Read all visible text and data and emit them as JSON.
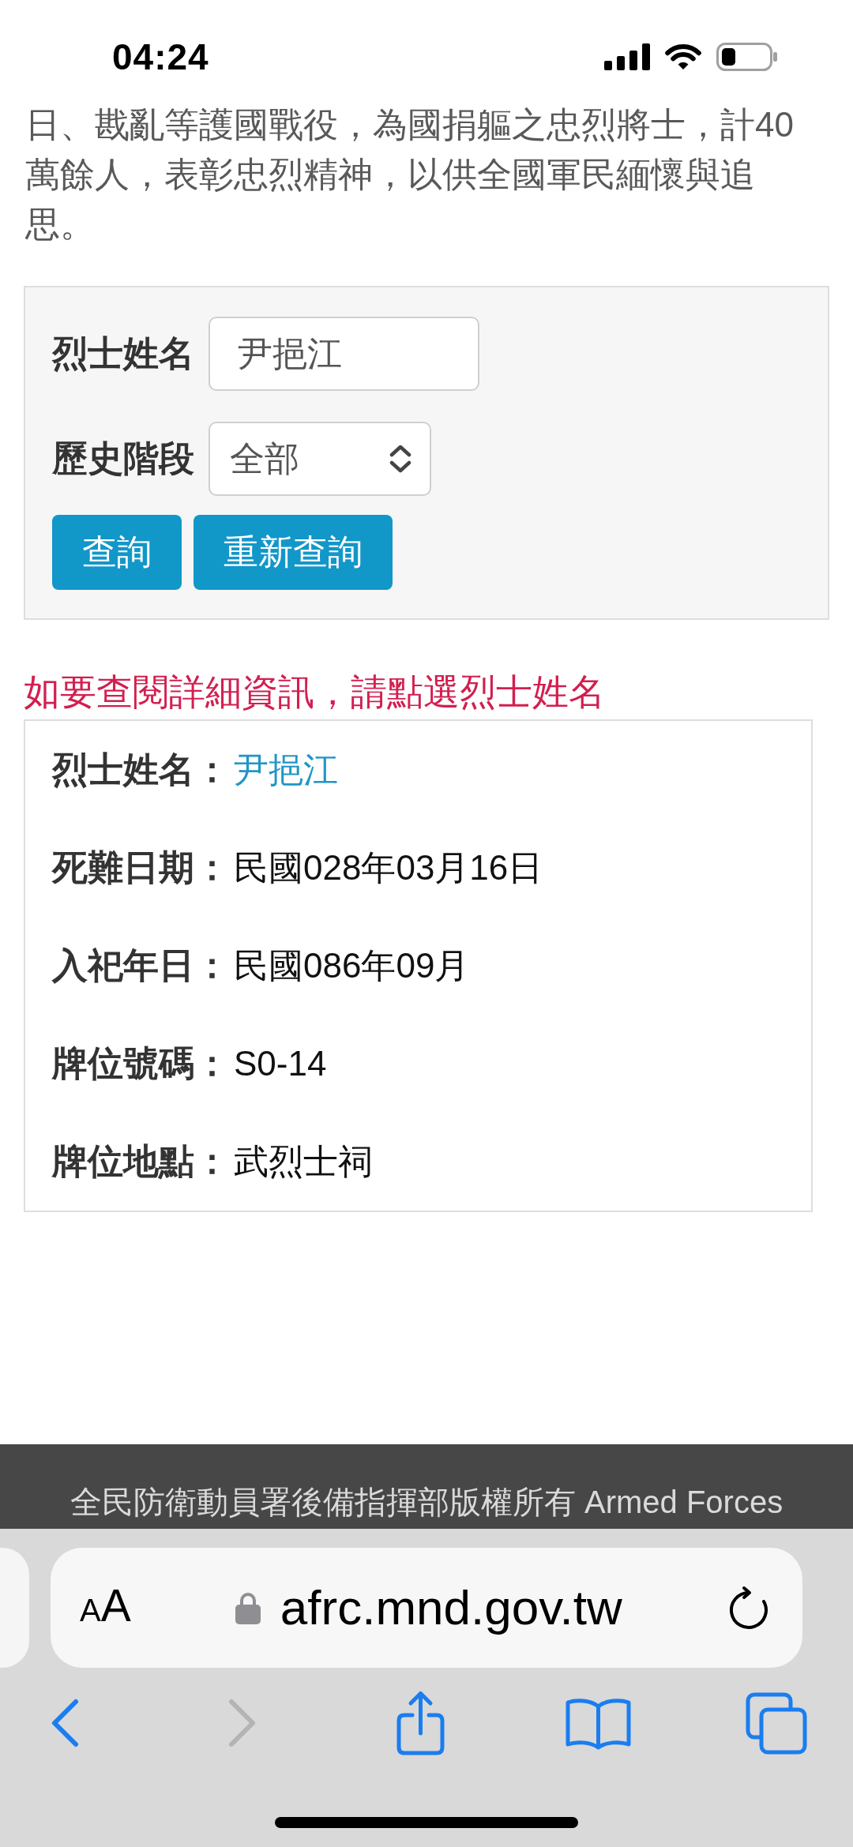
{
  "status_bar": {
    "time": "04:24"
  },
  "intro": {
    "text": "日、戡亂等護國戰役，為國捐軀之忠烈將士，計40萬餘人，表彰忠烈精神，以供全國軍民緬懷與追思。"
  },
  "search_form": {
    "fields": [
      {
        "kind": "text",
        "label": "烈士姓名",
        "value": "尹挹江"
      },
      {
        "kind": "select",
        "label": "歷史階段",
        "value": "全部"
      }
    ],
    "buttons": [
      "查詢",
      "重新查詢"
    ]
  },
  "notice": {
    "text": "如要查閱詳細資訊，請點選烈士姓名"
  },
  "result": {
    "rows": [
      {
        "kind": "link",
        "label": "烈士姓名：",
        "value": "尹挹江"
      },
      {
        "kind": "text",
        "label": "死難日期：",
        "value": "民國028年03月16日"
      },
      {
        "kind": "text",
        "label": "入祀年日：",
        "value": "民國086年09月"
      },
      {
        "kind": "text",
        "label": "牌位號碼：",
        "value": "S0-14"
      },
      {
        "kind": "text",
        "label": "牌位地點：",
        "value": "武烈士祠"
      }
    ]
  },
  "footer": {
    "text": "全民防衛動員署後備指揮部版權所有 Armed Forces"
  },
  "browser": {
    "format_button": "AA",
    "url": "afrc.mnd.gov.tw",
    "toolbar": [
      {
        "kind": "back",
        "disabled": false
      },
      {
        "kind": "forward",
        "disabled": true
      },
      {
        "kind": "share",
        "disabled": false
      },
      {
        "kind": "bookmarks",
        "disabled": false
      },
      {
        "kind": "tabs",
        "disabled": false
      }
    ]
  }
}
